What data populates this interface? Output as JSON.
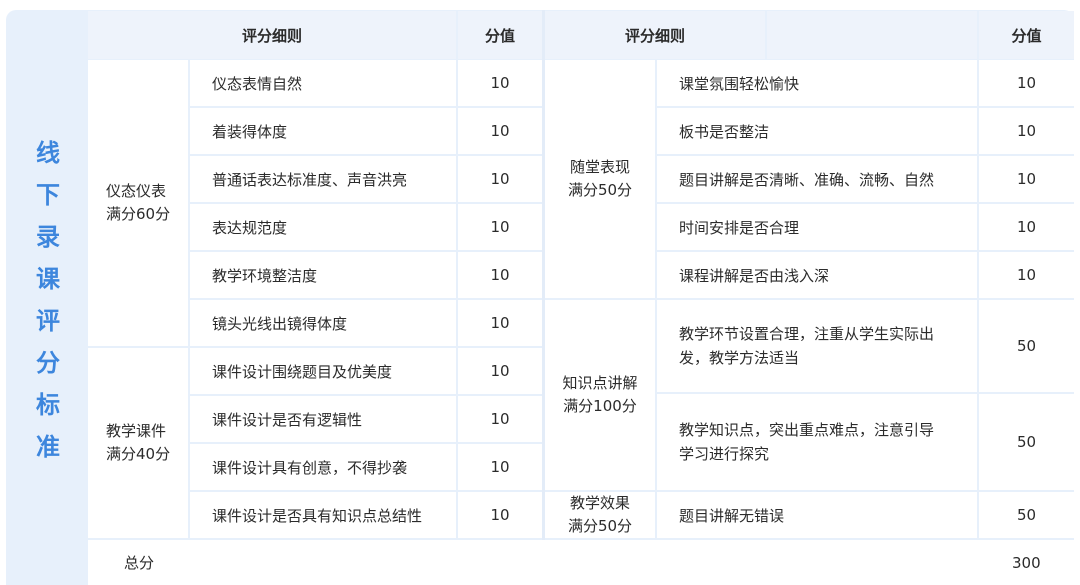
{
  "side_title": [
    "线",
    "下",
    "录",
    "课",
    "评",
    "分",
    "标",
    "准"
  ],
  "headers": {
    "left_criteria": "评分细则",
    "left_score": "分值",
    "right_criteria": "评分细则",
    "right_score": "分值"
  },
  "left_groups": [
    {
      "label_line1": "仪态仪表",
      "label_line2": "满分60分",
      "rows": [
        {
          "item": "仪态表情自然",
          "score": "10"
        },
        {
          "item": "着装得体度",
          "score": "10"
        },
        {
          "item": "普通话表达标准度、声音洪亮",
          "score": "10"
        },
        {
          "item": "表达规范度",
          "score": "10"
        },
        {
          "item": "教学环境整洁度",
          "score": "10"
        },
        {
          "item": "镜头光线出镜得体度",
          "score": "10"
        }
      ]
    },
    {
      "label_line1": "教学课件",
      "label_line2": "满分40分",
      "rows": [
        {
          "item": "课件设计围绕题目及优美度",
          "score": "10"
        },
        {
          "item": "课件设计是否有逻辑性",
          "score": "10"
        },
        {
          "item": "课件设计具有创意，不得抄袭",
          "score": "10"
        },
        {
          "item": "课件设计是否具有知识点总结性",
          "score": "10"
        }
      ]
    }
  ],
  "right_groups": [
    {
      "label_line1": "随堂表现",
      "label_line2": "满分50分",
      "rows": [
        {
          "item": "课堂氛围轻松愉快",
          "score": "10"
        },
        {
          "item": "板书是否整洁",
          "score": "10"
        },
        {
          "item": "题目讲解是否清晰、准确、流畅、自然",
          "score": "10"
        },
        {
          "item": "时间安排是否合理",
          "score": "10"
        },
        {
          "item": "课程讲解是否由浅入深",
          "score": "10"
        }
      ]
    },
    {
      "label_line1": "知识点讲解",
      "label_line2": "满分100分",
      "rows": [
        {
          "item_line1": "教学环节设置合理，注重从学生实际出",
          "item_line2": "发，教学方法适当",
          "score": "50"
        },
        {
          "item_line1": "教学知识点，突出重点难点，注意引导",
          "item_line2": "学习进行探究",
          "score": "50"
        }
      ]
    },
    {
      "label_line1": "教学效果",
      "label_line2": "满分50分",
      "rows": [
        {
          "item": "题目讲解无错误",
          "score": "50"
        }
      ]
    }
  ],
  "total": {
    "label": "总分",
    "value": "300"
  }
}
